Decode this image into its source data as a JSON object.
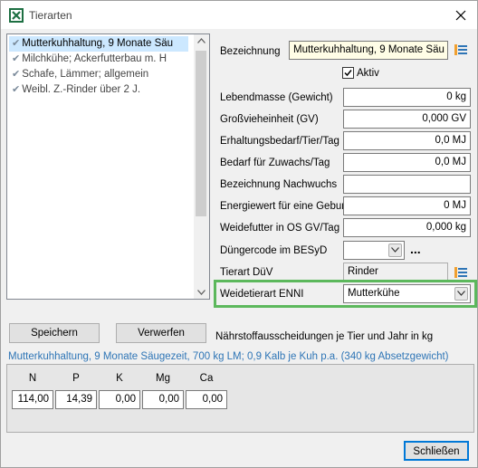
{
  "window": {
    "title": "Tierarten",
    "close_label": "×"
  },
  "list": {
    "items": [
      {
        "label": "Mutterkuhhaltung, 9 Monate Säu",
        "checked": true,
        "selected": true
      },
      {
        "label": "Milchkühe; Ackerfutterbau m. H",
        "checked": true,
        "selected": false
      },
      {
        "label": "Schafe, Lämmer; allgemein",
        "checked": true,
        "selected": false
      },
      {
        "label": "Weibl. Z.-Rinder über 2 J.",
        "checked": true,
        "selected": false
      }
    ]
  },
  "buttons": {
    "save": "Speichern",
    "discard": "Verwerfen",
    "close": "Schließen"
  },
  "form": {
    "bezeichnung_label": "Bezeichnung",
    "bezeichnung_value": "Mutterkuhhaltung, 9 Monate Säu",
    "aktiv_label": "Aktiv",
    "aktiv_checked": true,
    "lebendmasse_label": "Lebendmasse (Gewicht)",
    "lebendmasse_value": "0 kg",
    "gv_label": "Großvieheinheit (GV)",
    "gv_value": "0,000 GV",
    "erhaltung_label": "Erhaltungsbedarf/Tier/Tag",
    "erhaltung_value": "0,0 MJ",
    "zuwachs_label": "Bedarf für Zuwachs/Tag",
    "zuwachs_value": "0,0 MJ",
    "nachwuchs_label": "Bezeichnung Nachwuchs",
    "nachwuchs_value": "",
    "energiewert_label": "Energiewert für eine Geburt",
    "energiewert_value": "0 MJ",
    "weidefutter_label": "Weidefutter in OS GV/Tag",
    "weidefutter_value": "0,000 kg",
    "duengercode_label": "Düngercode im BESyD",
    "duengercode_value": "",
    "duengercode_more": "...",
    "tierart_duev_label": "Tierart DüV",
    "tierart_duev_value": "Rinder",
    "weidetierart_label": "Weidetierart ENNI",
    "weidetierart_value": "Mutterkühe"
  },
  "nutrients": {
    "heading": "Nährstoffausscheidungen je Tier und Jahr in kg",
    "summary": "Mutterkuhhaltung, 9 Monate Säugezeit, 700 kg LM; 0,9 Kalb je Kuh p.a. (340 kg Absetzgewicht)",
    "columns": [
      {
        "label": "N",
        "value": "114,00"
      },
      {
        "label": "P",
        "value": "14,39"
      },
      {
        "label": "K",
        "value": "0,00"
      },
      {
        "label": "Mg",
        "value": "0,00"
      },
      {
        "label": "Ca",
        "value": "0,00"
      }
    ]
  },
  "colors": {
    "highlight": "#5cb85c",
    "selection": "#cce8ff",
    "summary_text": "#2e75b6"
  }
}
